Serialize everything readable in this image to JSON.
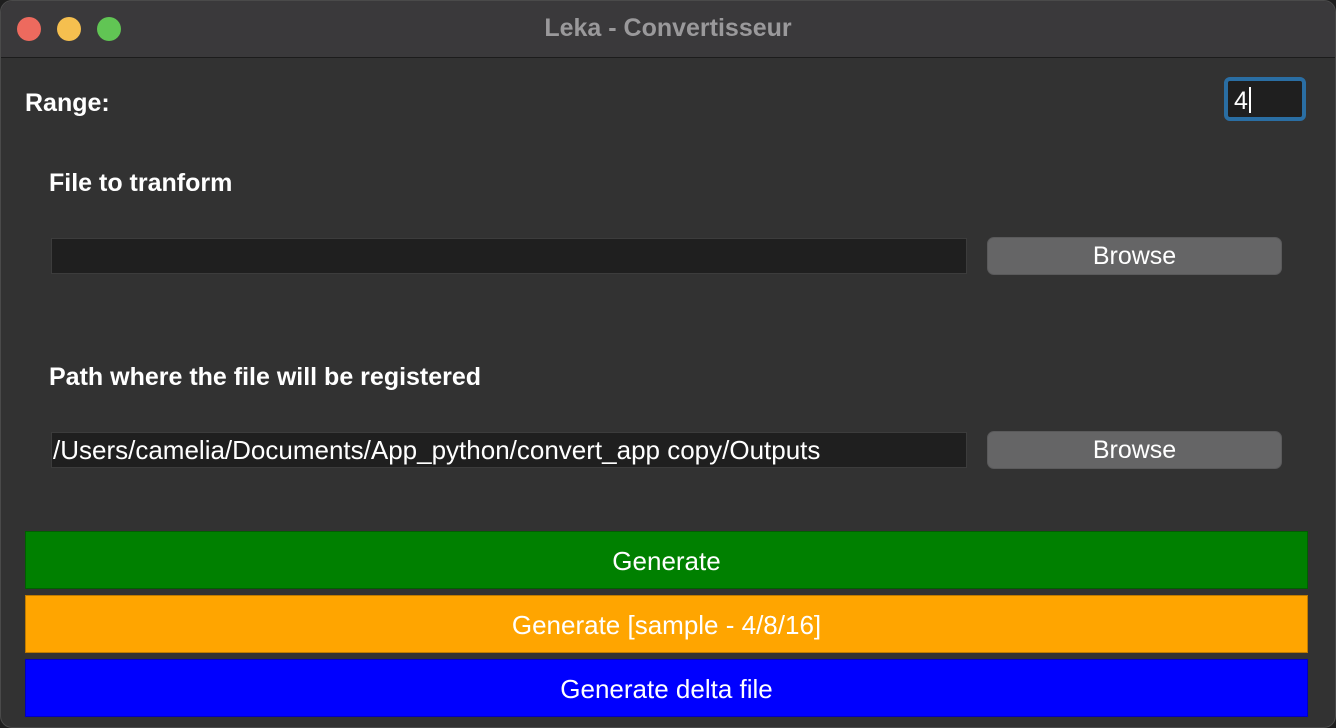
{
  "window": {
    "title": "Leka - Convertisseur"
  },
  "range": {
    "label": "Range:",
    "value": "4"
  },
  "file_section": {
    "label": "File to tranform",
    "value": "",
    "browse_label": "Browse"
  },
  "path_section": {
    "label": "Path where the file will be registered",
    "value": "/Users/camelia/Documents/App_python/convert_app copy/Outputs",
    "browse_label": "Browse"
  },
  "actions": {
    "generate_label": "Generate",
    "sample_label": "Generate [sample - 4/8/16]",
    "delta_label": "Generate delta file"
  },
  "colors": {
    "generate": "#008000",
    "sample": "#ffa500",
    "delta": "#0000ff",
    "focus_ring": "#2a6ea3"
  }
}
